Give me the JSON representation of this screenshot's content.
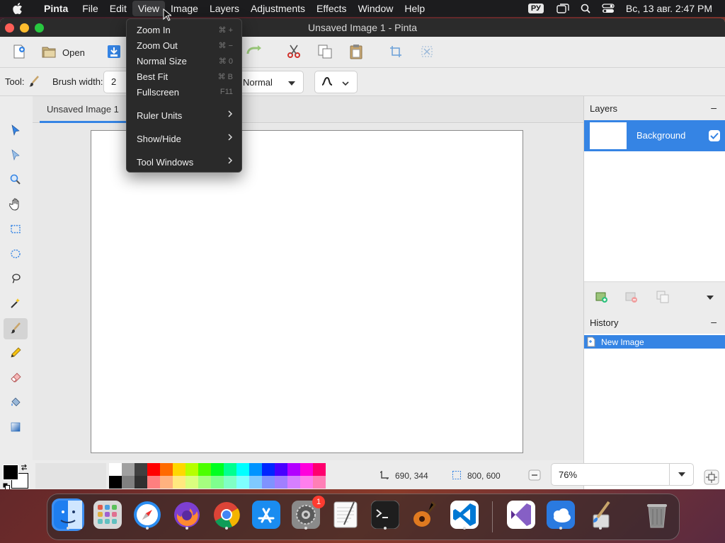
{
  "menubar": {
    "app_name": "Pinta",
    "menus": [
      "File",
      "Edit",
      "View",
      "Image",
      "Layers",
      "Adjustments",
      "Effects",
      "Window",
      "Help"
    ],
    "input_source": "РУ",
    "clock": "Вс, 13 авг.  2:47 PM"
  },
  "window": {
    "title": "Unsaved Image 1 - Pinta"
  },
  "toolbar": {
    "open_label": "Open"
  },
  "tool_options": {
    "tool_label": "Tool:",
    "brush_width_label": "Brush width:",
    "brush_width_value": "2",
    "blend_mode": "Normal"
  },
  "document": {
    "tab_label": "Unsaved Image 1"
  },
  "view_menu": {
    "items": [
      {
        "label": "Zoom In",
        "shortcut": "⌘ +"
      },
      {
        "label": "Zoom Out",
        "shortcut": "⌘ −"
      },
      {
        "label": "Normal Size",
        "shortcut": "⌘ 0"
      },
      {
        "label": "Best Fit",
        "shortcut": "⌘ B"
      },
      {
        "label": "Fullscreen",
        "shortcut": "F11"
      },
      {
        "label": "Ruler Units",
        "submenu": true
      },
      {
        "label": "Show/Hide",
        "submenu": true
      },
      {
        "label": "Tool Windows",
        "submenu": true
      }
    ]
  },
  "layers_panel": {
    "title": "Layers",
    "collapse": "–",
    "layers": [
      {
        "name": "Background",
        "visible": true
      }
    ]
  },
  "history_panel": {
    "title": "History",
    "collapse": "–",
    "items": [
      "New Image"
    ]
  },
  "statusbar": {
    "cursor_position": "690, 344",
    "selection_size": "800, 600",
    "zoom": "76%"
  },
  "palette": {
    "primary": "#000000",
    "secondary": "#ffffff",
    "top_row": [
      "#ffffff",
      "#a0a0a0",
      "#404040",
      "#ff0000",
      "#ff6a00",
      "#ffd800",
      "#b6ff00",
      "#4cff00",
      "#00ff21",
      "#00ff90",
      "#00ffff",
      "#0094ff",
      "#0026ff",
      "#4800ff",
      "#b200ff",
      "#ff00dc",
      "#ff006e"
    ],
    "bottom_row": [
      "#000000",
      "#808080",
      "#303030",
      "#ff7f7f",
      "#ffb27f",
      "#ffe97f",
      "#daff7f",
      "#a5ff7f",
      "#7fff8e",
      "#7fffc5",
      "#7fffff",
      "#7fc9ff",
      "#7f92ff",
      "#a17fff",
      "#d67fff",
      "#ff7fed",
      "#ff7fb6"
    ]
  },
  "dock": {
    "apps": [
      "finder-icon",
      "launchpad-icon",
      "safari-icon",
      "firefox-icon",
      "chrome-icon",
      "app-store-icon",
      "system-settings-icon",
      "textedit-icon",
      "terminal-icon",
      "garageband-icon",
      "vscode-icon",
      "visual-studio-icon",
      "weather-icon",
      "pinta-icon",
      "trash-icon"
    ],
    "settings_badge": "1"
  },
  "colors": {
    "accent": "#3584e4",
    "menubar": "#1c1c1e",
    "menu_bg": "#2a2a2a"
  }
}
